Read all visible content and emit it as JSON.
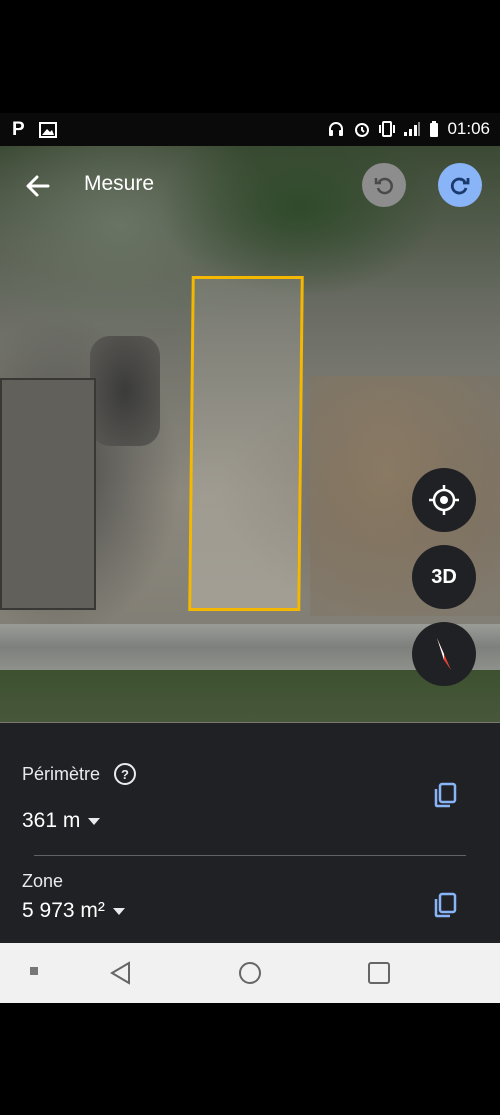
{
  "status_bar": {
    "left_icons": [
      "parking-icon",
      "image-icon"
    ],
    "left_p": "P",
    "right_icons": [
      "headset-icon",
      "alarm-icon",
      "vibrate-icon",
      "signal-icon",
      "battery-icon"
    ],
    "time": "01:06"
  },
  "header": {
    "title": "Mesure",
    "back_icon": "arrow-left-icon",
    "undo_icon": "undo-icon",
    "redo_icon": "redo-icon"
  },
  "map_controls": {
    "locate_icon": "my-location-icon",
    "three_d_label": "3D",
    "compass_icon": "compass-icon"
  },
  "measurement": {
    "perimeter_label": "Périmètre",
    "perimeter_value": "361 m",
    "area_label": "Zone",
    "area_value": "5 973 m²"
  },
  "colors": {
    "outline": "#f5b800",
    "redo_bg": "#8ab4f8",
    "sheet_bg": "#202124"
  }
}
